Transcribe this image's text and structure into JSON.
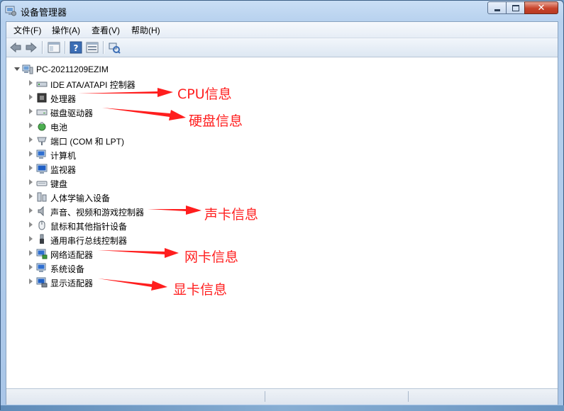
{
  "window": {
    "title": "设备管理器"
  },
  "menu": [
    {
      "label": "文件(F)"
    },
    {
      "label": "操作(A)"
    },
    {
      "label": "查看(V)"
    },
    {
      "label": "帮助(H)"
    }
  ],
  "toolbar": [
    "back-icon",
    "forward-icon",
    "properties-view-icon",
    "help-icon",
    "scan-icon",
    "update-driver-icon"
  ],
  "tree": {
    "root": {
      "label": "PC-20211209EZIM",
      "icon": "computer-icon",
      "expanded": true
    },
    "categories": [
      {
        "label": "IDE ATA/ATAPI 控制器",
        "icon": "ide-controller-icon"
      },
      {
        "label": "处理器",
        "icon": "processor-icon"
      },
      {
        "label": "磁盘驱动器",
        "icon": "disk-drive-icon"
      },
      {
        "label": "电池",
        "icon": "battery-icon"
      },
      {
        "label": "端口 (COM 和 LPT)",
        "icon": "port-icon"
      },
      {
        "label": "计算机",
        "icon": "computer-icon"
      },
      {
        "label": "监视器",
        "icon": "monitor-icon"
      },
      {
        "label": "键盘",
        "icon": "keyboard-icon"
      },
      {
        "label": "人体学输入设备",
        "icon": "hid-icon"
      },
      {
        "label": "声音、视频和游戏控制器",
        "icon": "speaker-icon"
      },
      {
        "label": "鼠标和其他指针设备",
        "icon": "mouse-icon"
      },
      {
        "label": "通用串行总线控制器",
        "icon": "usb-icon"
      },
      {
        "label": "网络适配器",
        "icon": "network-adapter-icon"
      },
      {
        "label": "系统设备",
        "icon": "system-device-icon"
      },
      {
        "label": "显示适配器",
        "icon": "display-adapter-icon"
      }
    ]
  },
  "annotations": [
    {
      "text": "CPU信息"
    },
    {
      "text": "硬盘信息"
    },
    {
      "text": "声卡信息"
    },
    {
      "text": "网卡信息"
    },
    {
      "text": "显卡信息"
    }
  ],
  "colors": {
    "annotation": "#ff1e1e",
    "title_bar": "#b7d1ee",
    "close_button": "#c7432b"
  }
}
